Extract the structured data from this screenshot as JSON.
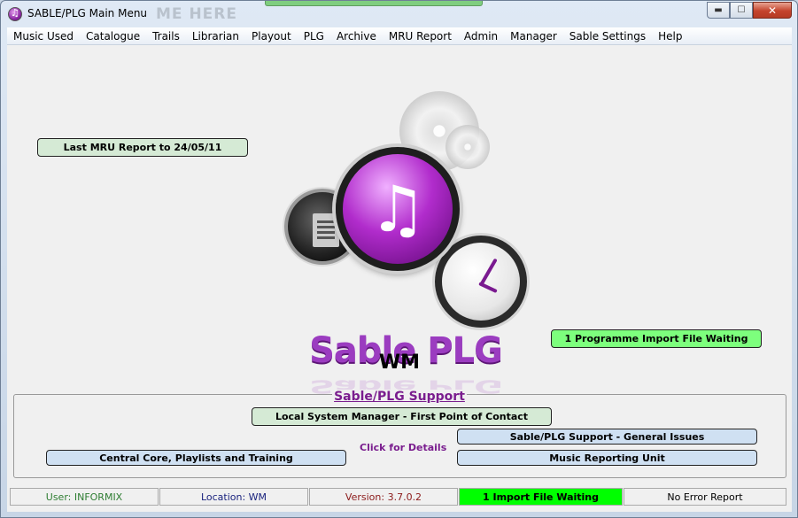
{
  "window": {
    "title": "SABLE/PLG Main Menu",
    "ghost_title": "ME HERE"
  },
  "menu": [
    "Music Used",
    "Catalogue",
    "Trails",
    "Librarian",
    "Playout",
    "PLG",
    "Archive",
    "MRU Report",
    "Admin",
    "Manager",
    "Sable Settings",
    "Help"
  ],
  "main": {
    "mru_report_button": "Last MRU Report to 24/05/11",
    "import_waiting_button": "1 Programme Import File Waiting",
    "brand": "Sable PLG",
    "location_code": "WM"
  },
  "support": {
    "title": "Sable/PLG Support",
    "local_manager_button": "Local System Manager - First Point of Contact",
    "general_issues_button": "Sable/PLG Support - General Issues",
    "central_core_button": "Central Core, Playlists and Training",
    "music_reporting_button": "Music Reporting Unit",
    "click_for_details": "Click for Details"
  },
  "status": {
    "user": "User: INFORMIX",
    "location": "Location: WM",
    "version": "Version: 3.7.0.2",
    "imports": "1 Import File Waiting",
    "errors": "No Error Report"
  },
  "colors": {
    "user": "#2e7d32",
    "location": "#1a237e",
    "version": "#8b1a1a",
    "imports_bg": "#00ff00",
    "brand": "#9b3cc0"
  }
}
